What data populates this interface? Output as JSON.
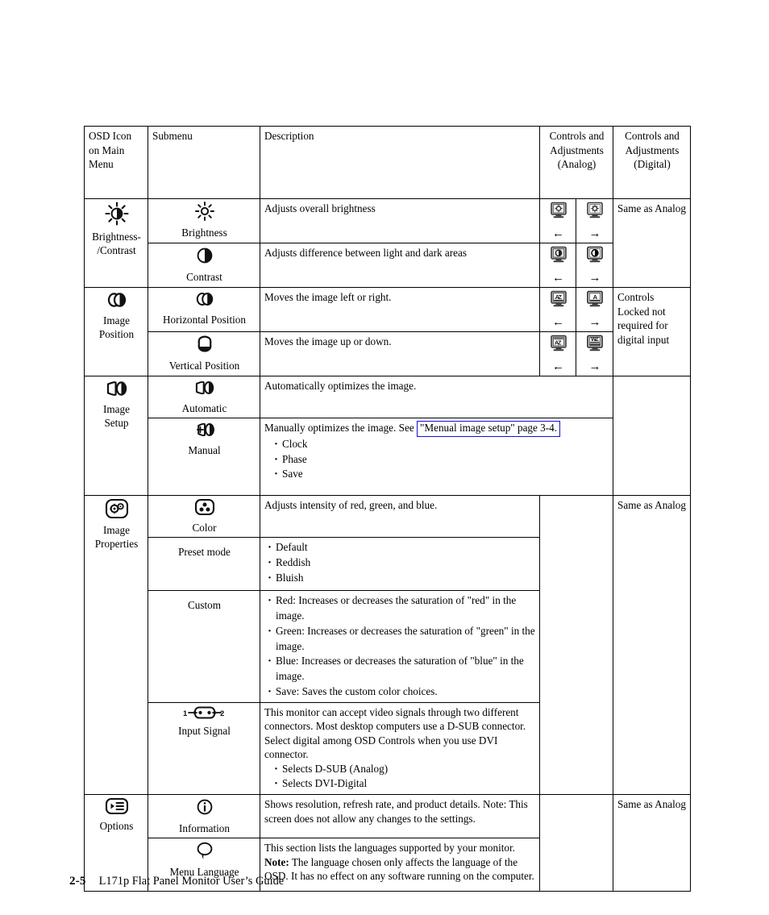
{
  "document": {
    "footer": {
      "page_number": "2-5",
      "title": "L171p Flat Panel Monitor User’s Guide"
    }
  },
  "table": {
    "headers": {
      "osd_icon": "OSD Icon on Main Menu",
      "submenu": "Submenu",
      "description": "Description",
      "controls_analog": "Controls and Adjustments (Analog)",
      "controls_digital": "Controls and Adjustments (Digital)"
    },
    "groups": [
      {
        "name": "brightness-contrast",
        "osd_label_line1": "Brightness-",
        "osd_label_line2": "/Contrast",
        "osd_icon": "brightness-contrast-icon",
        "digital": "Same as Analog",
        "rows": [
          {
            "submenu": "Brightness",
            "submenu_icon": "sun-icon",
            "description": "Adjusts overall brightness",
            "analog_left_icon": "monitor-brightness-icon",
            "analog_left_arrow": "←",
            "analog_right_icon": "monitor-brightness-bright-icon",
            "analog_right_arrow": "→"
          },
          {
            "submenu": "Contrast",
            "submenu_icon": "half-circle-icon",
            "description": "Adjusts difference between light and dark areas",
            "analog_left_icon": "monitor-contrast-low-icon",
            "analog_left_arrow": "←",
            "analog_right_icon": "monitor-contrast-high-icon",
            "analog_right_arrow": "→"
          }
        ]
      },
      {
        "name": "image-position",
        "osd_label_line1": "Image",
        "osd_label_line2": "Position",
        "osd_icon": "image-position-icon",
        "digital": "Controls Locked not required for digital input",
        "rows": [
          {
            "submenu": "Horizontal Position",
            "submenu_icon": "image-position-icon",
            "description": "Moves the image left or right.",
            "analog_left_icon": "monitor-hpos-left-icon",
            "analog_left_arrow": "←",
            "analog_right_icon": "monitor-hpos-right-icon",
            "analog_right_arrow": "→"
          },
          {
            "submenu": "Vertical Position",
            "submenu_icon": "vertical-position-icon",
            "description": "Moves the image up or down.",
            "analog_left_icon": "monitor-vpos-down-icon",
            "analog_left_arrow": "←",
            "analog_right_icon": "monitor-vpos-up-icon",
            "analog_right_arrow": "→"
          }
        ]
      },
      {
        "name": "image-setup",
        "osd_label_line1": "Image",
        "osd_label_line2": "Setup",
        "osd_icon": "image-setup-icon",
        "digital": "",
        "rows": [
          {
            "submenu": "Automatic",
            "submenu_icon": "image-setup-icon",
            "description": "Automatically optimizes the image."
          },
          {
            "submenu": "Manual",
            "submenu_icon": "image-setup-manual-icon",
            "description_prefix": "Manually optimizes the image. See",
            "link_text": "\"Menual image setup\" page 3-4.",
            "link_color": "#1111dd",
            "bullets": [
              "Clock",
              "Phase",
              "Save"
            ]
          }
        ]
      },
      {
        "name": "image-properties",
        "osd_label_line1": "Image",
        "osd_label_line2": "Properties",
        "osd_icon": "image-properties-icon",
        "digital": "Same as Analog",
        "rows": [
          {
            "submenu": "Color",
            "submenu_icon": "color-icon",
            "description": "Adjusts intensity of red, green, and blue."
          },
          {
            "submenu": "Preset mode",
            "bullets": [
              "Default",
              "Reddish",
              "Bluish"
            ]
          },
          {
            "submenu": "Custom",
            "bullets": [
              "Red: Increases or decreases the saturation of \"red\" in the image.",
              "Green: Increases or decreases the saturation of \"green\" in the image.",
              "Blue: Increases or decreases the saturation of \"blue\"  in the image.",
              "Save: Saves the custom color choices."
            ]
          },
          {
            "submenu": "Input  Signal",
            "submenu_icon": "input-signal-icon",
            "description": "This monitor can accept video signals through two different connectors. Most desktop computers use a D-SUB connector. Select digital among OSD Controls when you use DVI connector.",
            "bullets": [
              "Selects D-SUB (Analog)",
              "Selects DVI-Digital"
            ]
          }
        ]
      },
      {
        "name": "options",
        "osd_label_line1": "Options",
        "osd_label_line2": "",
        "osd_icon": "options-icon",
        "digital": "Same as Analog",
        "rows": [
          {
            "submenu": "Information",
            "submenu_icon": "information-icon",
            "description": "Shows resolution, refresh rate, and product details. Note: This screen does not allow any changes to the settings."
          },
          {
            "submenu": "Menu Language",
            "submenu_icon": "speech-bubble-icon",
            "description_line1": "This section lists the languages supported by your monitor.",
            "note_label": "Note:",
            "description_line2": " The language chosen only affects the language of the OSD. It has no effect on any software running on the computer."
          }
        ]
      }
    ]
  }
}
